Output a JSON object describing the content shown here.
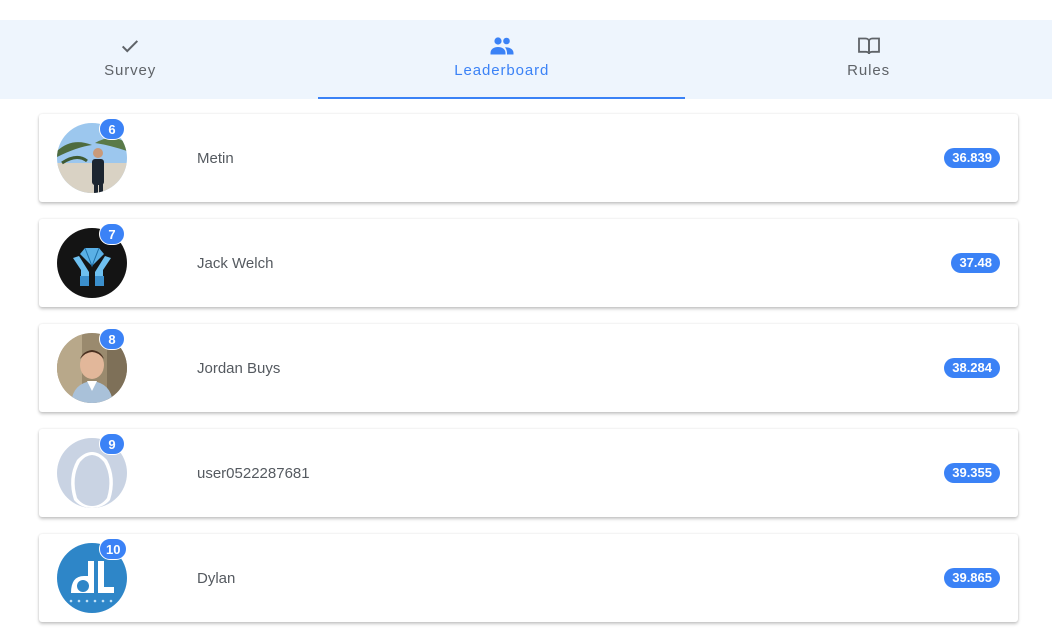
{
  "tabs": [
    {
      "label": "Survey",
      "icon": "check-icon",
      "active": false
    },
    {
      "label": "Leaderboard",
      "icon": "people-icon",
      "active": true
    },
    {
      "label": "Rules",
      "icon": "book-icon",
      "active": false
    }
  ],
  "colors": {
    "accent": "#3b82f6",
    "tabbar_bg": "#eef5fd"
  },
  "leaderboard": [
    {
      "rank": "6",
      "name": "Metin",
      "score": "36.839"
    },
    {
      "rank": "7",
      "name": "Jack Welch",
      "score": "37.48"
    },
    {
      "rank": "8",
      "name": "Jordan Buys",
      "score": "38.284"
    },
    {
      "rank": "9",
      "name": "user0522287681",
      "score": "39.355"
    },
    {
      "rank": "10",
      "name": "Dylan",
      "score": "39.865"
    }
  ]
}
